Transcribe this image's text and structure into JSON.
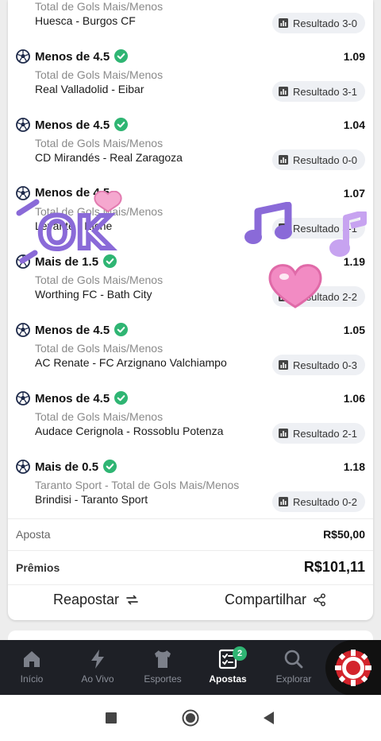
{
  "bets": [
    {
      "market": "",
      "type": "Total de Gols Mais/Menos",
      "teams": "Huesca - Burgos CF",
      "odd": "",
      "result": "Resultado 3-0"
    },
    {
      "market": "Menos de 4.5",
      "type": "Total de Gols Mais/Menos",
      "teams": "Real Valladolid - Eibar",
      "odd": "1.09",
      "result": "Resultado 3-1"
    },
    {
      "market": "Menos de 4.5",
      "type": "Total de Gols Mais/Menos",
      "teams": "CD Mirandés - Real Zaragoza",
      "odd": "1.04",
      "result": "Resultado 0-0"
    },
    {
      "market": "Menos de 4.5",
      "type": "Total de Gols Mais/Menos",
      "teams": "Levante - Elche",
      "odd": "1.07",
      "result": "Resultado 3-1"
    },
    {
      "market": "Mais de 1.5",
      "type": "Total de Gols Mais/Menos",
      "teams": "Worthing FC - Bath City",
      "odd": "1.19",
      "result": "Resultado 2-2"
    },
    {
      "market": "Menos de 4.5",
      "type": "Total de Gols Mais/Menos",
      "teams": "AC Renate - FC Arzignano Valchiampo",
      "odd": "1.05",
      "result": "Resultado 0-3"
    },
    {
      "market": "Menos de 4.5",
      "type": "Total de Gols Mais/Menos",
      "teams": "Audace Cerignola - Rossoblu Potenza",
      "odd": "1.06",
      "result": "Resultado 2-1"
    },
    {
      "market": "Mais de 0.5",
      "type": "Taranto Sport - Total de Gols Mais/Menos",
      "teams": "Brindisi - Taranto Sport",
      "odd": "1.18",
      "result": "Resultado 0-2"
    }
  ],
  "summary": {
    "stake_label": "Aposta",
    "stake_value": "R$50,00",
    "prize_label": "Prêmios",
    "prize_value": "R$101,11"
  },
  "actions": {
    "rebet": "Reapostar",
    "share": "Compartilhar"
  },
  "stickers": {
    "ok_text": "OK"
  },
  "nav": {
    "items": [
      {
        "label": "Início",
        "icon": "home-icon"
      },
      {
        "label": "Ao Vivo",
        "icon": "lightning-icon"
      },
      {
        "label": "Esportes",
        "icon": "jersey-icon"
      },
      {
        "label": "Apostas",
        "icon": "betslip-icon",
        "badge": "2",
        "active": true
      },
      {
        "label": "Explorar",
        "icon": "search-icon"
      }
    ],
    "casino_icon": "casino-chip-icon"
  },
  "system_nav": [
    "recents-icon",
    "home-icon",
    "back-icon"
  ],
  "colors": {
    "win_green": "#2fb573",
    "nav_bg": "#1e2026",
    "casino_red": "#d3242c"
  }
}
